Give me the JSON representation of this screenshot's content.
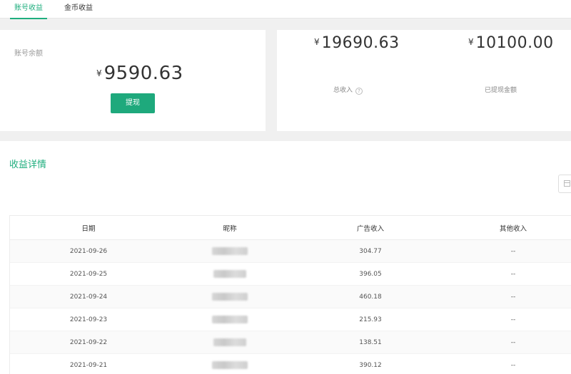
{
  "tabs": [
    {
      "label": "账号收益",
      "active": true
    },
    {
      "label": "金币收益",
      "active": false
    }
  ],
  "balance": {
    "label": "账号余额",
    "currency": "¥",
    "amount": "9590.63",
    "withdraw_label": "提现"
  },
  "summary": {
    "total_income": {
      "currency": "¥",
      "amount": "19690.63",
      "label": "总收入",
      "help_icon": "?"
    },
    "withdrawn": {
      "currency": "¥",
      "amount": "10100.00",
      "label": "已提现金额"
    }
  },
  "details": {
    "title": "收益详情",
    "columns": [
      "日期",
      "昵称",
      "广告收入",
      "其他收入"
    ],
    "rows": [
      {
        "date": "2021-09-26",
        "ad_income": "304.77",
        "other": "--"
      },
      {
        "date": "2021-09-25",
        "ad_income": "396.05",
        "other": "--"
      },
      {
        "date": "2021-09-24",
        "ad_income": "460.18",
        "other": "--"
      },
      {
        "date": "2021-09-23",
        "ad_income": "215.93",
        "other": "--"
      },
      {
        "date": "2021-09-22",
        "ad_income": "138.51",
        "other": "--"
      },
      {
        "date": "2021-09-21",
        "ad_income": "390.12",
        "other": "--"
      }
    ]
  },
  "colors": {
    "accent": "#1fae7e",
    "button": "#1ea97c"
  }
}
